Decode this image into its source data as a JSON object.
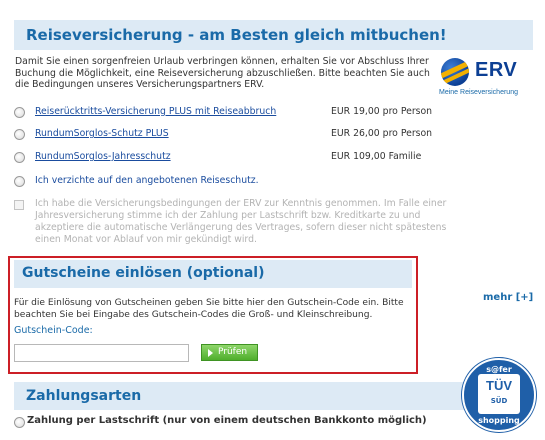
{
  "insurance": {
    "title": "Reiseversicherung - am Besten gleich mitbuchen!",
    "intro": "Damit Sie einen sorgenfreien Urlaub verbringen können, erhalten Sie vor Abschluss Ihrer Buchung die Möglichkeit, eine Reiseversicherung abzuschließen. Bitte beachten Sie auch die Bedingungen unseres Versicherungspartners ERV.",
    "logo": {
      "word": "ERV",
      "tagline": "Meine Reiseversicherung"
    },
    "options": [
      {
        "label": "Reiserücktritts-Versicherung PLUS mit Reiseabbruch",
        "price": "EUR 19,00 pro Person"
      },
      {
        "label": "RundumSorglos-Schutz PLUS",
        "price": "EUR 26,00 pro Person"
      },
      {
        "label": "RundumSorglos-Jahresschutz",
        "price": "EUR 109,00 Familie"
      }
    ],
    "decline": "Ich verzichte auf den angebotenen Reiseschutz.",
    "terms": "Ich habe die Versicherungsbedingungen der ERV zur Kenntnis genommen. Im Falle einer Jahresversicherung stimme ich der Zahlung per Lastschrift bzw. Kreditkarte zu und akzeptiere die automatische Verlängerung des Vertrages, sofern dieser nicht spätestens einen Monat vor Ablauf von mir gekündigt wird."
  },
  "voucher": {
    "title": "Gutscheine einlösen (optional)",
    "text": "Für die Einlösung von Gutscheinen geben Sie bitte hier den Gutschein-Code ein. Bitte beachten Sie bei Eingabe des Gutschein-Codes die Groß- und Kleinschreibung.",
    "code_label": "Gutschein-Code:",
    "code_value": "",
    "button": "Prüfen"
  },
  "more_link": "mehr [+]",
  "payment": {
    "title": "Zahlungsarten",
    "option": "Zahlung per Lastschrift (nur von einem deutschen Bankkonto möglich)"
  },
  "badge": {
    "top": "s@fer",
    "mark": "TÜV",
    "sub": "SÜD",
    "bottom": "shopping"
  },
  "colors": {
    "accent": "#1a6aa8",
    "header_bg": "#ddeaf5",
    "highlight_border": "#cc1f26",
    "button_green": "#4fae2c"
  }
}
